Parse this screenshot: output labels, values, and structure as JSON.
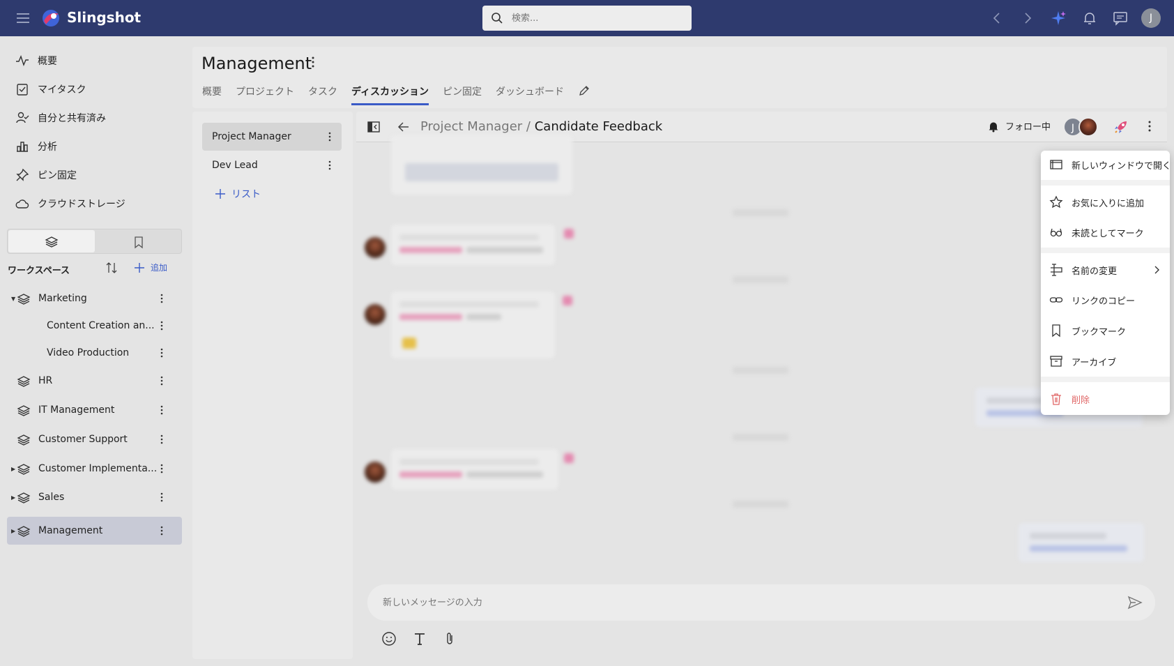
{
  "app": {
    "name": "Slingshot"
  },
  "search": {
    "placeholder": "検索..."
  },
  "user": {
    "initial": "J"
  },
  "nav": [
    {
      "label": "概要",
      "icon": "activity-icon"
    },
    {
      "label": "マイタスク",
      "icon": "task-check-icon"
    },
    {
      "label": "自分と共有済み",
      "icon": "shared-user-icon"
    },
    {
      "label": "分析",
      "icon": "bar-chart-icon"
    },
    {
      "label": "ピン固定",
      "icon": "pin-icon"
    },
    {
      "label": "クラウドストレージ",
      "icon": "cloud-icon"
    }
  ],
  "workspaces": {
    "title": "ワークスペース",
    "add_label": "追加",
    "items": [
      {
        "label": "Marketing",
        "expanded": true
      },
      {
        "label": "Content Creation an...",
        "sub": true
      },
      {
        "label": "Video Production",
        "sub": true
      },
      {
        "label": "HR"
      },
      {
        "label": "IT Management"
      },
      {
        "label": "Customer Support"
      },
      {
        "label": "Customer Implementa...",
        "collapsed": true
      },
      {
        "label": "Sales",
        "collapsed": true
      },
      {
        "label": "Management",
        "collapsed": true,
        "active": true
      }
    ]
  },
  "workspace": {
    "title": "Management",
    "tabs": [
      "概要",
      "プロジェクト",
      "タスク",
      "ディスカッション",
      "ピン固定",
      "ダッシュボード"
    ],
    "active_tab": "ディスカッション"
  },
  "lists": {
    "items": [
      "Project Manager",
      "Dev Lead"
    ],
    "add_label": "リスト"
  },
  "discussion": {
    "parent": "Project Manager /",
    "title": "Candidate Feedback",
    "follow_label": "フォロー中",
    "member_initial": "J",
    "composer_placeholder": "新しいメッセージの入力"
  },
  "context_menu": {
    "items": [
      {
        "label": "新しいウィンドウで開く",
        "icon": "new-window-icon"
      },
      {
        "label": "お気に入りに追加",
        "icon": "star-icon"
      },
      {
        "label": "未読としてマーク",
        "icon": "glasses-icon"
      },
      {
        "label": "名前の変更",
        "icon": "rename-icon",
        "submenu": true
      },
      {
        "label": "リンクのコピー",
        "icon": "link-icon"
      },
      {
        "label": "ブックマーク",
        "icon": "bookmark-icon"
      },
      {
        "label": "アーカイブ",
        "icon": "archive-icon"
      },
      {
        "label": "削除",
        "icon": "trash-icon",
        "danger": true
      }
    ]
  },
  "colors": {
    "topbar": "#2e3a6e",
    "accent": "#3a5bc7",
    "danger": "#e06666"
  }
}
